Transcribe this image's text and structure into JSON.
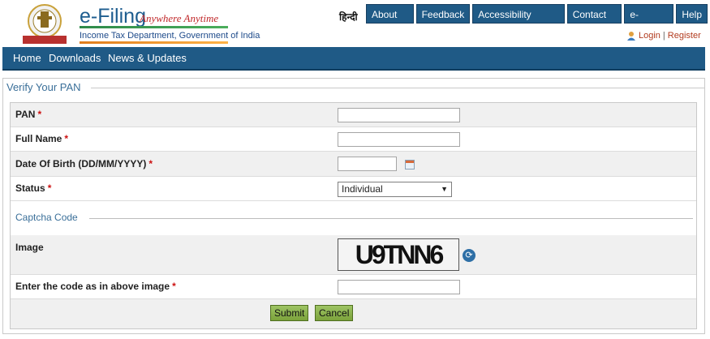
{
  "header": {
    "logo_title": "e-Filing",
    "logo_tagline": "Anywhere Anytime",
    "department": "Income Tax Department, Government of India",
    "hindi_link": "हिन्दी",
    "top_nav": [
      "About Us",
      "Feedback",
      "Accessibility Options",
      "Contact Us",
      "e-Nivaran",
      "Help"
    ],
    "login": "Login",
    "register": "Register",
    "login_separator": "|"
  },
  "main_nav": [
    "Home",
    "Downloads",
    "News & Updates"
  ],
  "page": {
    "title": "Verify Your PAN"
  },
  "form": {
    "pan_label": "PAN",
    "full_name_label": "Full Name",
    "dob_label": "Date Of Birth (DD/MM/YYYY)",
    "status_label": "Status",
    "status_value": "Individual",
    "required_mark": "*",
    "captcha_section": "Captcha Code",
    "image_label": "Image",
    "captcha_text": "U9TNN6",
    "code_label": "Enter the code as in above image",
    "submit_label": "Submit",
    "cancel_label": "Cancel"
  },
  "icons": {
    "calendar": "calendar-icon",
    "refresh": "refresh-icon",
    "user": "user-icon",
    "emblem": "emblem-icon"
  },
  "colors": {
    "nav_blue": "#1f5a86",
    "accent_red": "#c0282a",
    "button_green": "#8bb34b"
  }
}
